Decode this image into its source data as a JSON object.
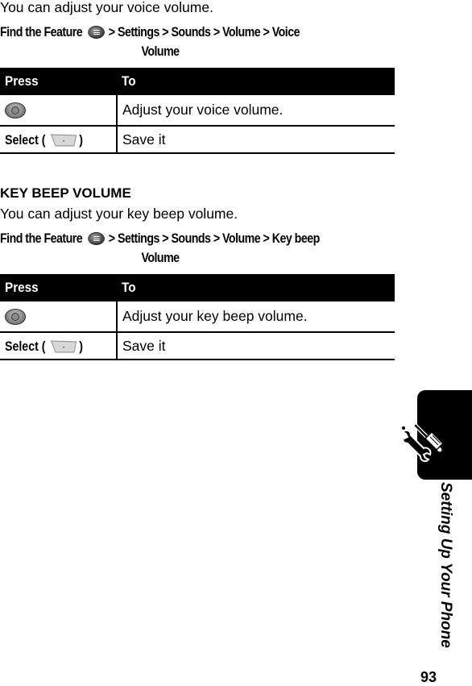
{
  "voice_volume": {
    "intro": "You can adjust your voice volume.",
    "find_label": "Find the Feature",
    "menu_icon": "menu-key-icon",
    "path_line1": "> Settings > Sounds > Volume > Voice",
    "path_line2": "Volume",
    "table": {
      "headers": [
        "Press",
        "To"
      ],
      "rows": [
        {
          "press_icon": "navigation-key-icon",
          "press_label": "",
          "to": "Adjust your voice volume."
        },
        {
          "press_label_prefix": "Select (",
          "press_icon": "left-soft-key-icon",
          "press_label_suffix": ")",
          "to": "Save it"
        }
      ]
    }
  },
  "key_beep_volume": {
    "heading": "KEY BEEP VOLUME",
    "intro": "You can adjust your key beep volume.",
    "find_label": "Find the Feature",
    "menu_icon": "menu-key-icon",
    "path_line1": "> Settings > Sounds > Volume > Key beep",
    "path_line2": "Volume",
    "table": {
      "headers": [
        "Press",
        "To"
      ],
      "rows": [
        {
          "press_icon": "navigation-key-icon",
          "press_label": "",
          "to": "Adjust your key beep volume."
        },
        {
          "press_label_prefix": "Select (",
          "press_icon": "left-soft-key-icon",
          "press_label_suffix": ")",
          "to": "Save it"
        }
      ]
    }
  },
  "side_tab": {
    "icon": "wrench-screwdriver-icon",
    "section_title": "Setting Up Your Phone",
    "tab_color": "#000000"
  },
  "page_number": "93"
}
